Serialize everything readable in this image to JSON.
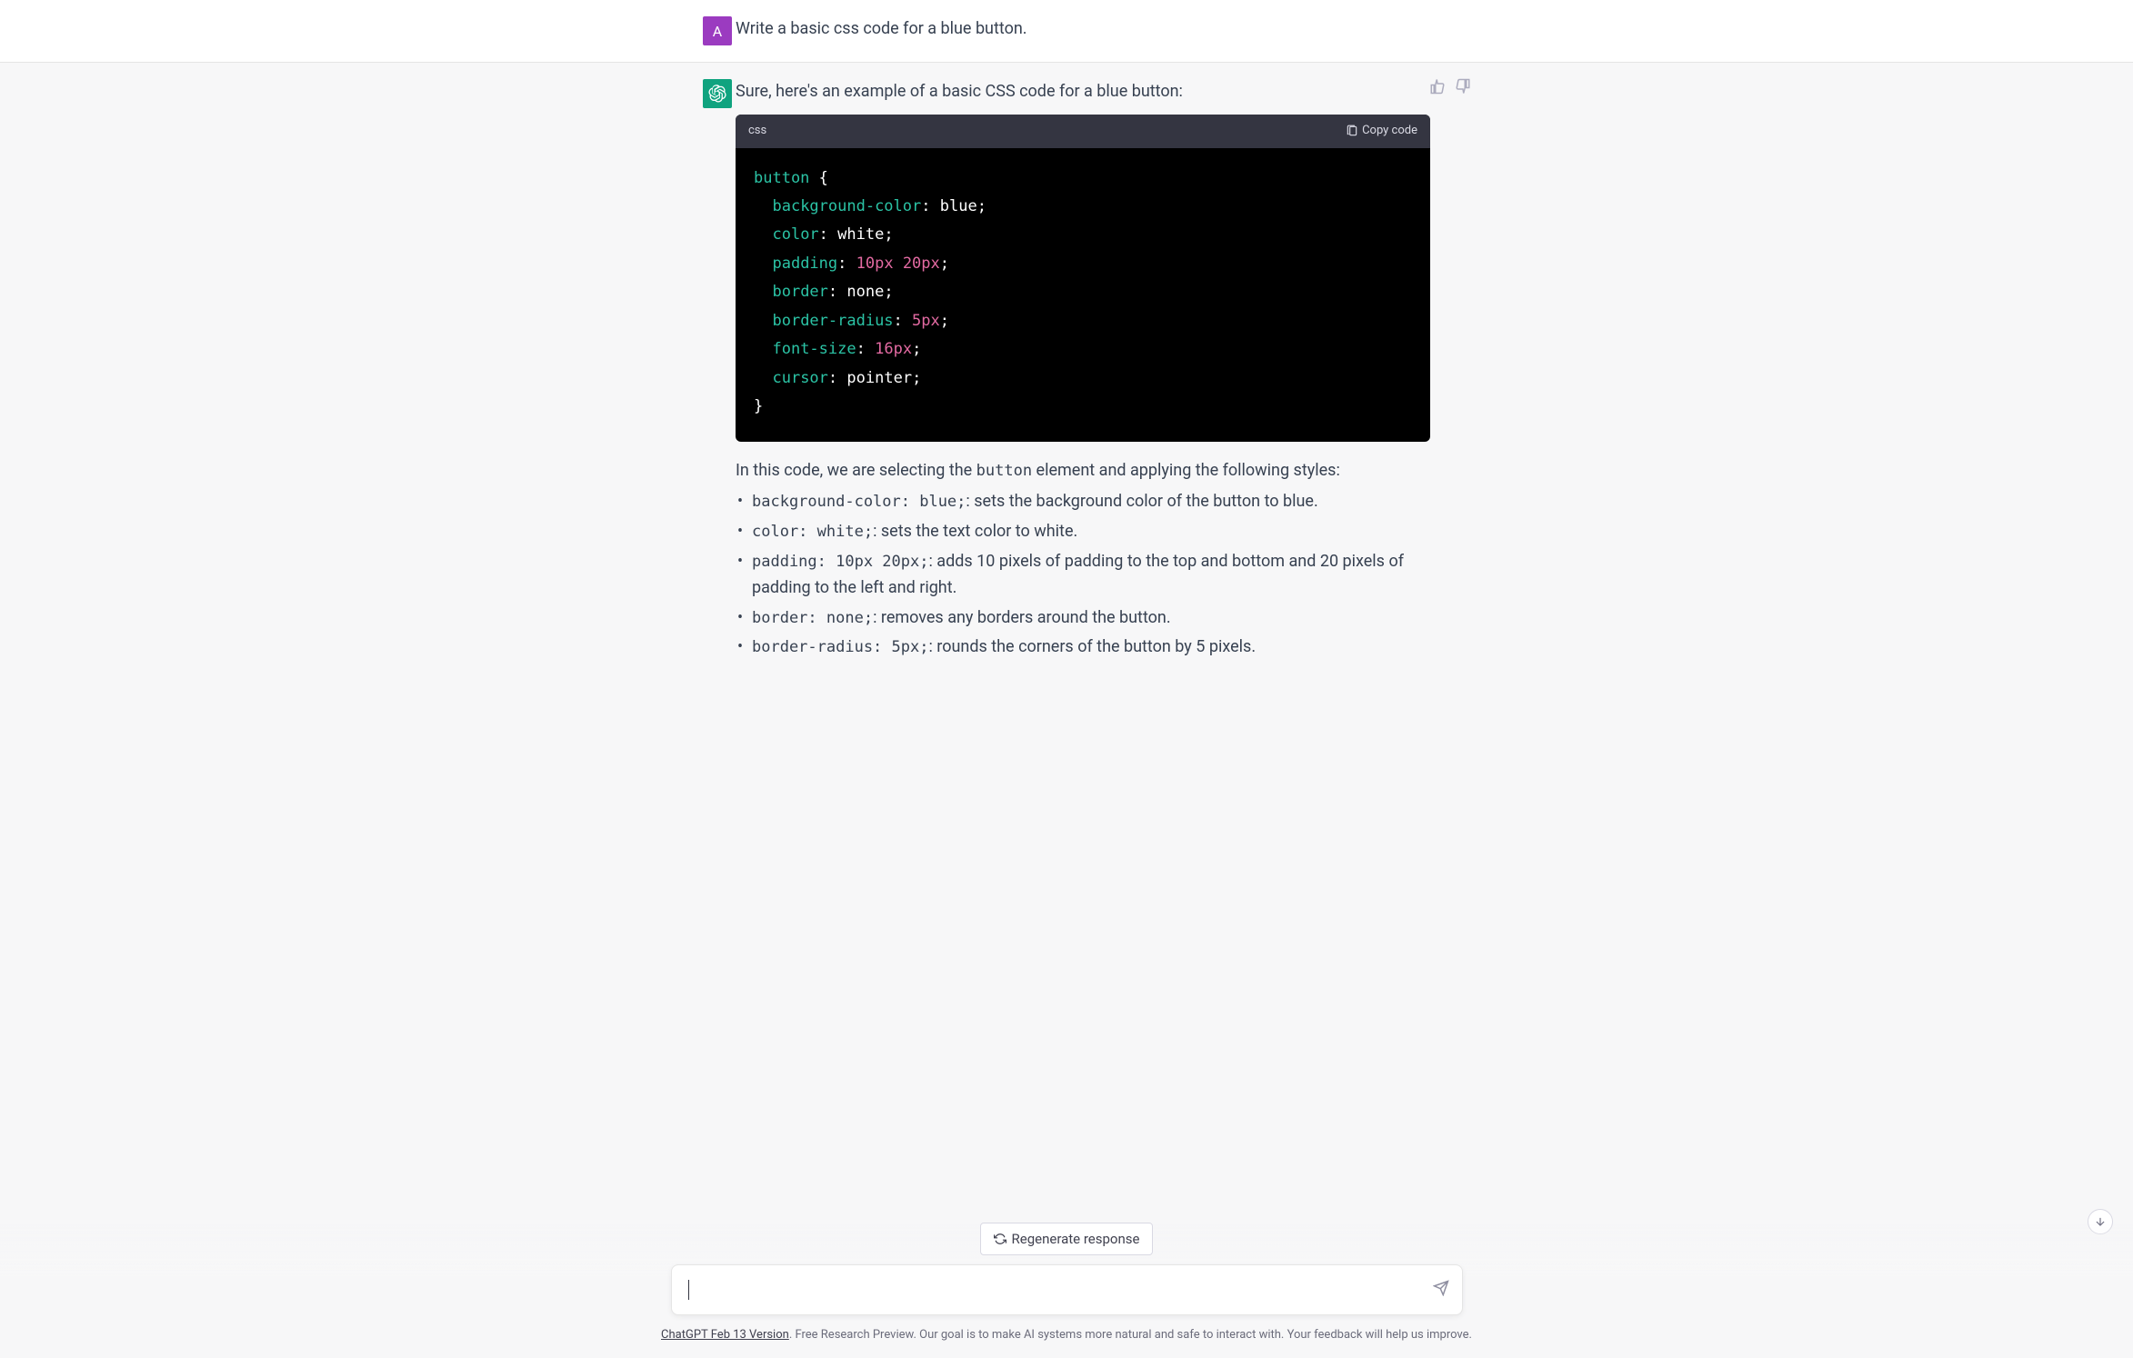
{
  "user": {
    "avatar_letter": "A",
    "message": "Write a basic css code for a blue button."
  },
  "assistant": {
    "intro": "Sure, here's an example of a basic CSS code for a blue button:",
    "code": {
      "language_label": "css",
      "copy_label": "Copy code",
      "lines": [
        {
          "type": "open",
          "selector": "button",
          "brace": "{"
        },
        {
          "type": "decl",
          "prop": "background-color",
          "val": "blue",
          "num": false
        },
        {
          "type": "decl",
          "prop": "color",
          "val": "white",
          "num": false
        },
        {
          "type": "decl",
          "prop": "padding",
          "val": "10px 20px",
          "num": true
        },
        {
          "type": "decl",
          "prop": "border",
          "val": "none",
          "num": false
        },
        {
          "type": "decl",
          "prop": "border-radius",
          "val": "5px",
          "num": true
        },
        {
          "type": "decl",
          "prop": "font-size",
          "val": "16px",
          "num": true
        },
        {
          "type": "decl",
          "prop": "cursor",
          "val": "pointer",
          "num": false
        },
        {
          "type": "close",
          "brace": "}"
        }
      ]
    },
    "explain_intro_pre": "In this code, we are selecting the ",
    "explain_intro_code": "button",
    "explain_intro_post": " element and applying the following styles:",
    "bullets": [
      {
        "code": "background-color: blue;",
        "text": ": sets the background color of the button to blue."
      },
      {
        "code": "color: white;",
        "text": ": sets the text color to white."
      },
      {
        "code": "padding: 10px 20px;",
        "text": ": adds 10 pixels of padding to the top and bottom and 20 pixels of padding to the left and right."
      },
      {
        "code": "border: none;",
        "text": ": removes any borders around the button."
      },
      {
        "code": "border-radius: 5px;",
        "text": ": rounds the corners of the button by 5 pixels."
      }
    ]
  },
  "controls": {
    "regenerate_label": "Regenerate response"
  },
  "footer": {
    "link_text": "ChatGPT Feb 13 Version",
    "rest": ". Free Research Preview. Our goal is to make AI systems more natural and safe to interact with. Your feedback will help us improve."
  }
}
